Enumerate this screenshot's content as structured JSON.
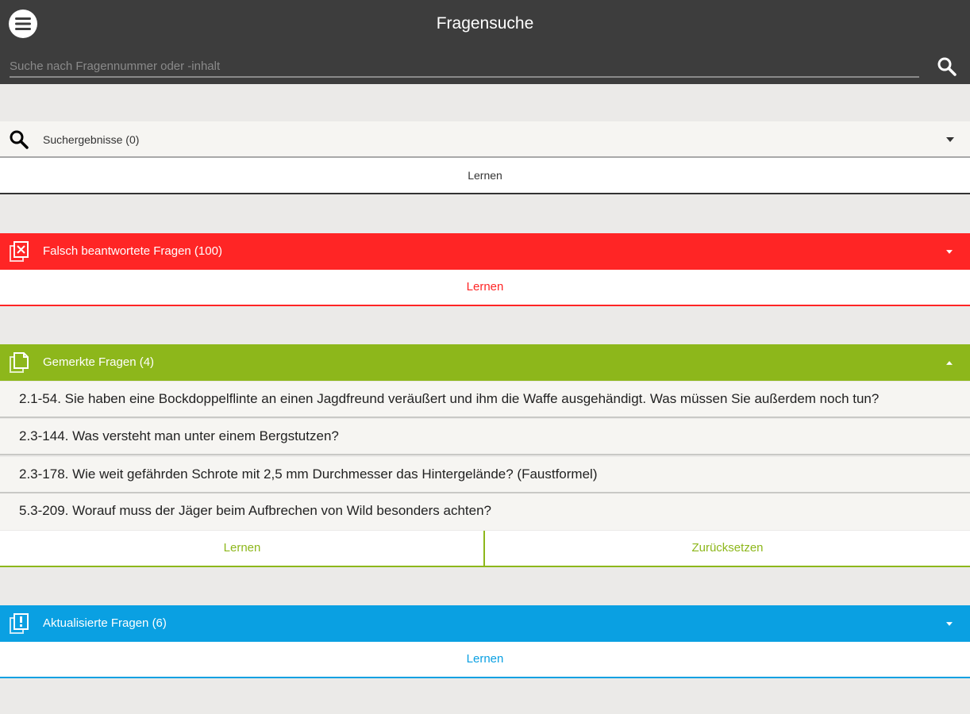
{
  "header": {
    "title": "Fragensuche",
    "search_placeholder": "Suche nach Fragennummer oder -inhalt",
    "bar_color": "#3d3d3d"
  },
  "sections": {
    "search_results": {
      "label": "Suchergebnisse (0)",
      "learn_label": "Lernen",
      "icon": "search-icon",
      "expanded": false
    },
    "wrong": {
      "label": "Falsch beantwortete Fragen (100)",
      "learn_label": "Lernen",
      "color": "#ff2525",
      "icon": "wrong-answers-icon",
      "expanded": false
    },
    "bookmarked": {
      "label": "Gemerkte Fragen (4)",
      "color": "#8db71b",
      "icon": "bookmarked-questions-icon",
      "expanded": true,
      "items": [
        "2.1-54. Sie haben eine Bockdoppelflinte an einen Jagdfreund veräußert und ihm die Waffe ausgehändigt. Was müssen  Sie außerdem noch tun?",
        "2.3-144. Was versteht man unter einem Bergstutzen?",
        "2.3-178. Wie weit gefährden Schrote mit 2,5 mm Durchmesser das Hintergelände? (Faustformel)",
        "5.3-209. Worauf muss der Jäger beim Aufbrechen von Wild besonders achten?"
      ],
      "learn_label": "Lernen",
      "reset_label": "Zurücksetzen"
    },
    "updated": {
      "label": "Aktualisierte Fragen (6)",
      "learn_label": "Lernen",
      "color": "#0aa0e2",
      "icon": "updated-questions-icon",
      "expanded": false
    }
  }
}
